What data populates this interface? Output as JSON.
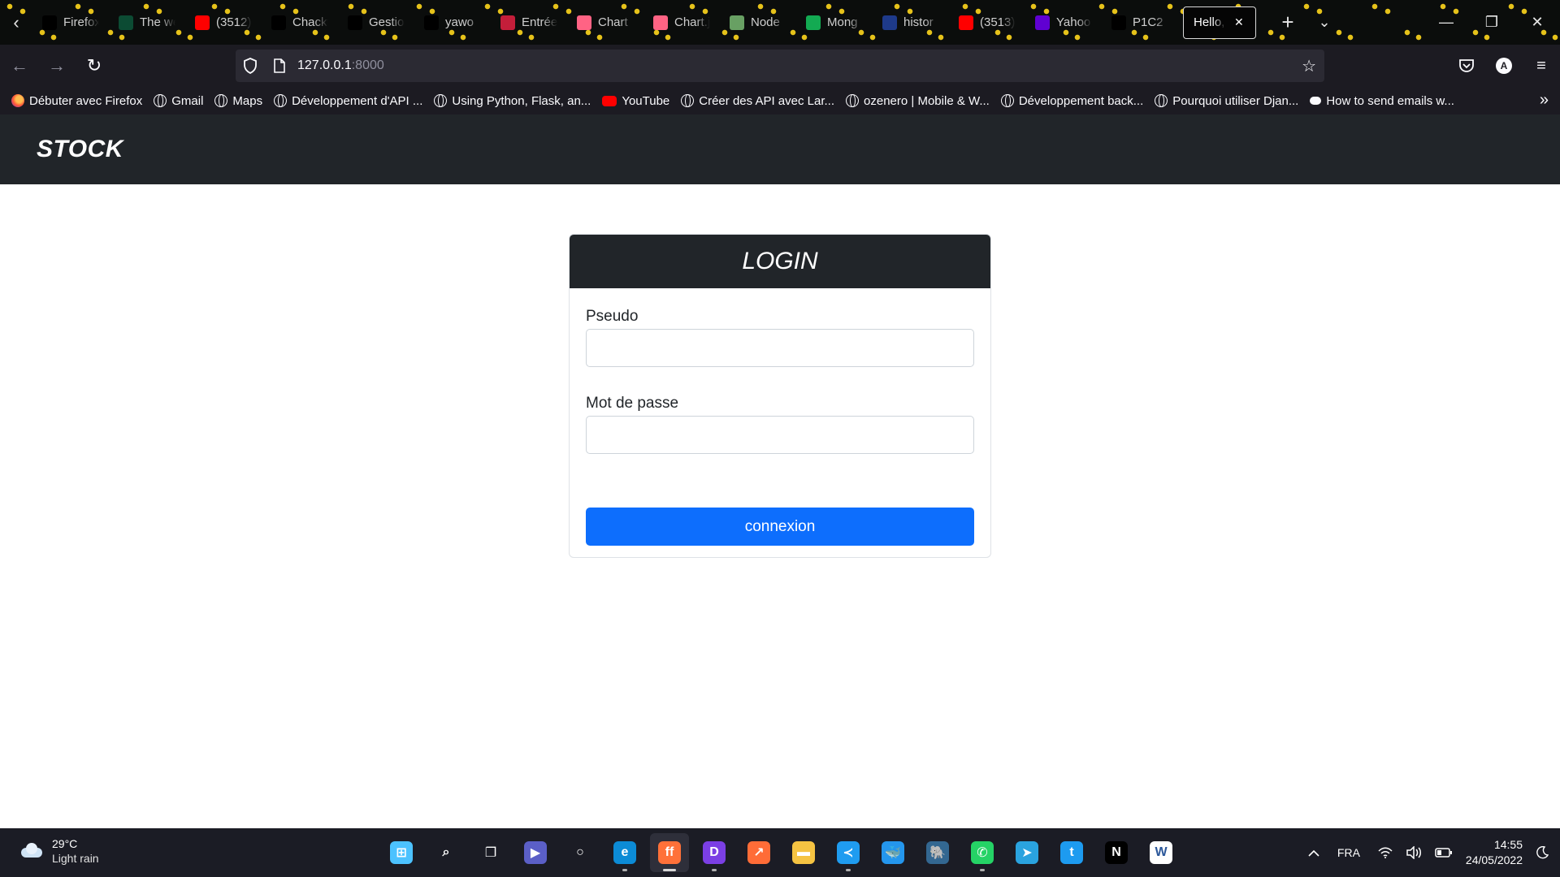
{
  "browser": {
    "tabs": [
      {
        "label": "Firefox",
        "icon": "medium-icon",
        "color": "#000000"
      },
      {
        "label": "The web",
        "icon": "django-icon",
        "color": "#0c4b33"
      },
      {
        "label": "(3512)",
        "icon": "youtube-icon",
        "color": "#ff0000"
      },
      {
        "label": "Chackt",
        "icon": "github-icon",
        "color": "#000000"
      },
      {
        "label": "Gestio",
        "icon": "puzzle-icon",
        "color": "#000000"
      },
      {
        "label": "yawo",
        "icon": "github-icon",
        "color": "#000000"
      },
      {
        "label": "Entrée",
        "icon": "figure-icon",
        "color": "#c41e3a"
      },
      {
        "label": "Chart",
        "icon": "chartjs-icon",
        "color": "#ff6384"
      },
      {
        "label": "Chart.j",
        "icon": "chartjs-icon",
        "color": "#ff6384"
      },
      {
        "label": "Node",
        "icon": "nodejs-icon",
        "color": "#68a063"
      },
      {
        "label": "Mong",
        "icon": "mongodb-icon",
        "color": "#13aa52"
      },
      {
        "label": "histor",
        "icon": "db-icon",
        "color": "#1e3a8a"
      },
      {
        "label": "(3513)",
        "icon": "youtube-icon",
        "color": "#ff0000"
      },
      {
        "label": "Yahoo",
        "icon": "yahoo-icon",
        "color": "#6001d2"
      },
      {
        "label": "P1C2",
        "icon": "openclassrooms-icon",
        "color": "#000000"
      }
    ],
    "active_tab": {
      "label": "Hello, w"
    },
    "url": {
      "host": "127.0.0.1",
      "port": ":8000"
    },
    "bookmarks": [
      {
        "label": "Débuter avec Firefox",
        "icon": "firefox"
      },
      {
        "label": "Gmail",
        "icon": "globe"
      },
      {
        "label": "Maps",
        "icon": "globe"
      },
      {
        "label": "Développement d'API ...",
        "icon": "globe"
      },
      {
        "label": "Using Python, Flask, an...",
        "icon": "globe"
      },
      {
        "label": "YouTube",
        "icon": "youtube"
      },
      {
        "label": "Créer des API avec Lar...",
        "icon": "globe"
      },
      {
        "label": "ozenero | Mobile & W...",
        "icon": "globe"
      },
      {
        "label": "Développement back...",
        "icon": "globe"
      },
      {
        "label": "Pourquoi utiliser Djan...",
        "icon": "globe"
      },
      {
        "label": "How to send emails w...",
        "icon": "medium"
      }
    ]
  },
  "app": {
    "brand": "STOCK",
    "login": {
      "title": "LOGIN",
      "username_label": "Pseudo",
      "username_value": "",
      "password_label": "Mot de passe",
      "password_value": "",
      "submit_label": "connexion"
    },
    "colors": {
      "navbar": "#212529",
      "primary": "#0d6efd"
    }
  },
  "taskbar": {
    "weather": {
      "temp": "29°C",
      "desc": "Light rain"
    },
    "apps": [
      {
        "name": "windows-start-icon",
        "color": "#4cc2ff",
        "glyph": "⊞",
        "running": false
      },
      {
        "name": "search-icon",
        "color": "transparent",
        "glyph": "⌕",
        "running": false
      },
      {
        "name": "task-view-icon",
        "color": "transparent",
        "glyph": "❐",
        "running": false
      },
      {
        "name": "teams-chat-icon",
        "color": "#5b5fc7",
        "glyph": "▶",
        "running": false
      },
      {
        "name": "cortana-icon",
        "color": "transparent",
        "glyph": "○",
        "running": false
      },
      {
        "name": "edge-icon",
        "color": "#0c8bd6",
        "glyph": "e",
        "running": true
      },
      {
        "name": "firefox-icon",
        "color": "#ff7139",
        "glyph": "ff",
        "running": true,
        "active": true
      },
      {
        "name": "discord-icon",
        "color": "#7b3fe4",
        "glyph": "D",
        "running": true
      },
      {
        "name": "postman-icon",
        "color": "#ff6c37",
        "glyph": "↗",
        "running": false
      },
      {
        "name": "file-explorer-icon",
        "color": "#f5c342",
        "glyph": "▬",
        "running": false
      },
      {
        "name": "vscode-icon",
        "color": "#1f9cf0",
        "glyph": "≺",
        "running": true
      },
      {
        "name": "docker-icon",
        "color": "#2496ed",
        "glyph": "🐳",
        "running": false
      },
      {
        "name": "postgresql-icon",
        "color": "#336791",
        "glyph": "🐘",
        "running": false
      },
      {
        "name": "whatsapp-icon",
        "color": "#25d366",
        "glyph": "✆",
        "running": true
      },
      {
        "name": "telegram-icon",
        "color": "#2aa3df",
        "glyph": "➤",
        "running": false
      },
      {
        "name": "twitter-icon",
        "color": "#1d9bf0",
        "glyph": "t",
        "running": false
      },
      {
        "name": "netflix-icon",
        "color": "#000000",
        "glyph": "N",
        "running": false
      },
      {
        "name": "word-online-icon",
        "color": "#ffffff",
        "glyph": "W",
        "running": false
      }
    ],
    "tray": {
      "language": "FRA",
      "time": "14:55",
      "date": "24/05/2022"
    }
  }
}
